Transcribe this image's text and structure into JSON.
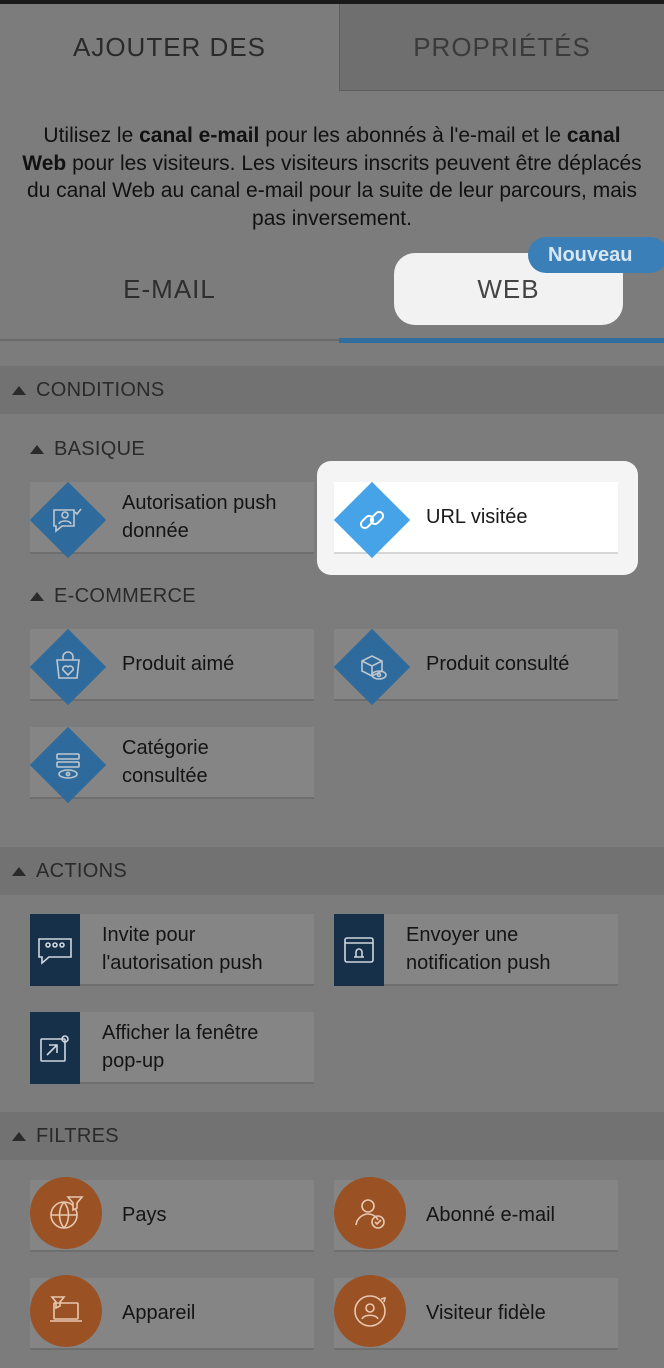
{
  "tabs": {
    "add": "AJOUTER DES",
    "properties": "PROPRIÉTÉS"
  },
  "intro": {
    "p1": "Utilisez le ",
    "b1": "canal e-mail",
    "p2": " pour les abonnés à l'e-mail et le ",
    "b2": "canal Web",
    "p3": " pour les visiteurs. Les visiteurs inscrits peuvent être déplacés du canal Web au canal e-mail pour la suite de leur parcours, mais pas inversement."
  },
  "channels": {
    "email": "E-MAIL",
    "web": "WEB",
    "new_badge": "Nouveau"
  },
  "sections": {
    "conditions": {
      "title": "CONDITIONS",
      "basique": {
        "title": "BASIQUE",
        "items": [
          "Autorisation push donnée",
          "URL visitée"
        ]
      },
      "ecommerce": {
        "title": "E-COMMERCE",
        "items": [
          "Produit aimé",
          "Produit consulté",
          "Catégorie consultée"
        ]
      }
    },
    "actions": {
      "title": "ACTIONS",
      "items": [
        "Invite pour l'autorisation push",
        "Envoyer une notification push",
        "Afficher la fenêtre pop-up"
      ]
    },
    "filters": {
      "title": "FILTRES",
      "items": [
        "Pays",
        "Abonné e-mail",
        "Appareil",
        "Visiteur fidèle"
      ]
    }
  },
  "colors": {
    "condition_diamond": "#2e6a9b",
    "highlight_diamond": "#46a3e8",
    "action_icon_bg": "#17304a",
    "filter_circle": "#9a5225",
    "tab_underline": "#2f6e9f",
    "badge": "#3a7fb8"
  },
  "icons": {
    "push_granted": "chat-user-check-icon",
    "url_visited": "link-icon",
    "product_liked": "bag-heart-icon",
    "product_viewed": "box-eye-icon",
    "category_viewed": "list-eye-icon",
    "push_prompt": "chat-dots-icon",
    "push_send": "bell-window-icon",
    "popup": "popup-arrow-icon",
    "country": "globe-filter-icon",
    "email_subscriber": "user-check-icon",
    "device": "laptop-filter-icon",
    "loyal_visitor": "user-refresh-icon"
  }
}
